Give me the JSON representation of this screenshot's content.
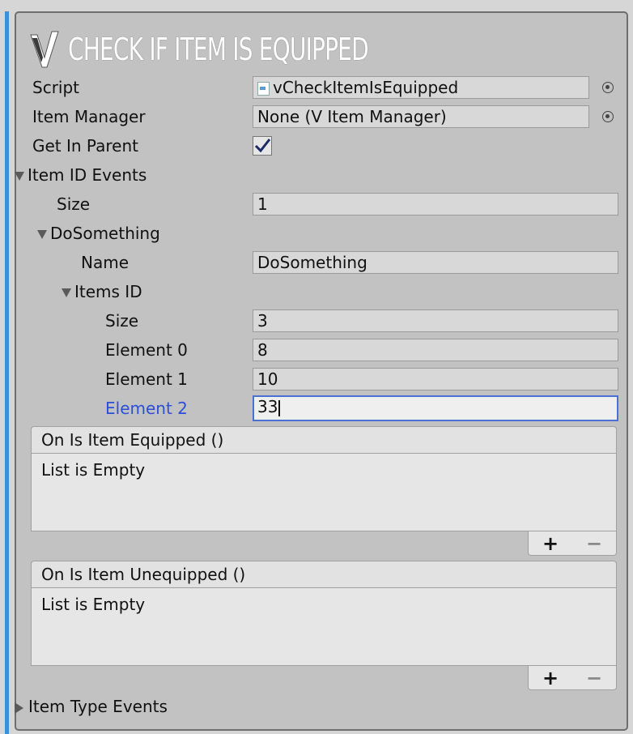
{
  "header": {
    "title": "CHECK IF ITEM IS EQUIPPED",
    "logo_icon": "v-logo-icon"
  },
  "props": {
    "script_label": "Script",
    "script_value": "vCheckItemIsEquipped",
    "item_manager_label": "Item Manager",
    "item_manager_value": "None (V Item Manager)",
    "get_in_parent_label": "Get In Parent",
    "get_in_parent_checked": true
  },
  "item_id_events": {
    "label": "Item ID Events",
    "size_label": "Size",
    "size_value": "1",
    "element": {
      "label": "DoSomething",
      "name_label": "Name",
      "name_value": "DoSomething",
      "items_id": {
        "label": "Items ID",
        "size_label": "Size",
        "size_value": "3",
        "elements": [
          {
            "label": "Element 0",
            "value": "8"
          },
          {
            "label": "Element 1",
            "value": "10"
          },
          {
            "label": "Element 2",
            "value": "33"
          }
        ]
      }
    }
  },
  "events": [
    {
      "title": "On Is Item Equipped ()",
      "empty_text": "List is Empty",
      "add": "+",
      "remove": "−"
    },
    {
      "title": "On Is Item Unequipped ()",
      "empty_text": "List is Empty",
      "add": "+",
      "remove": "−"
    }
  ],
  "item_type_events": {
    "label": "Item Type Events"
  },
  "colors": {
    "accent_blue": "#3f8fd6",
    "focus_blue": "#2b4fd6",
    "panel_bg": "#c2c2c2"
  }
}
